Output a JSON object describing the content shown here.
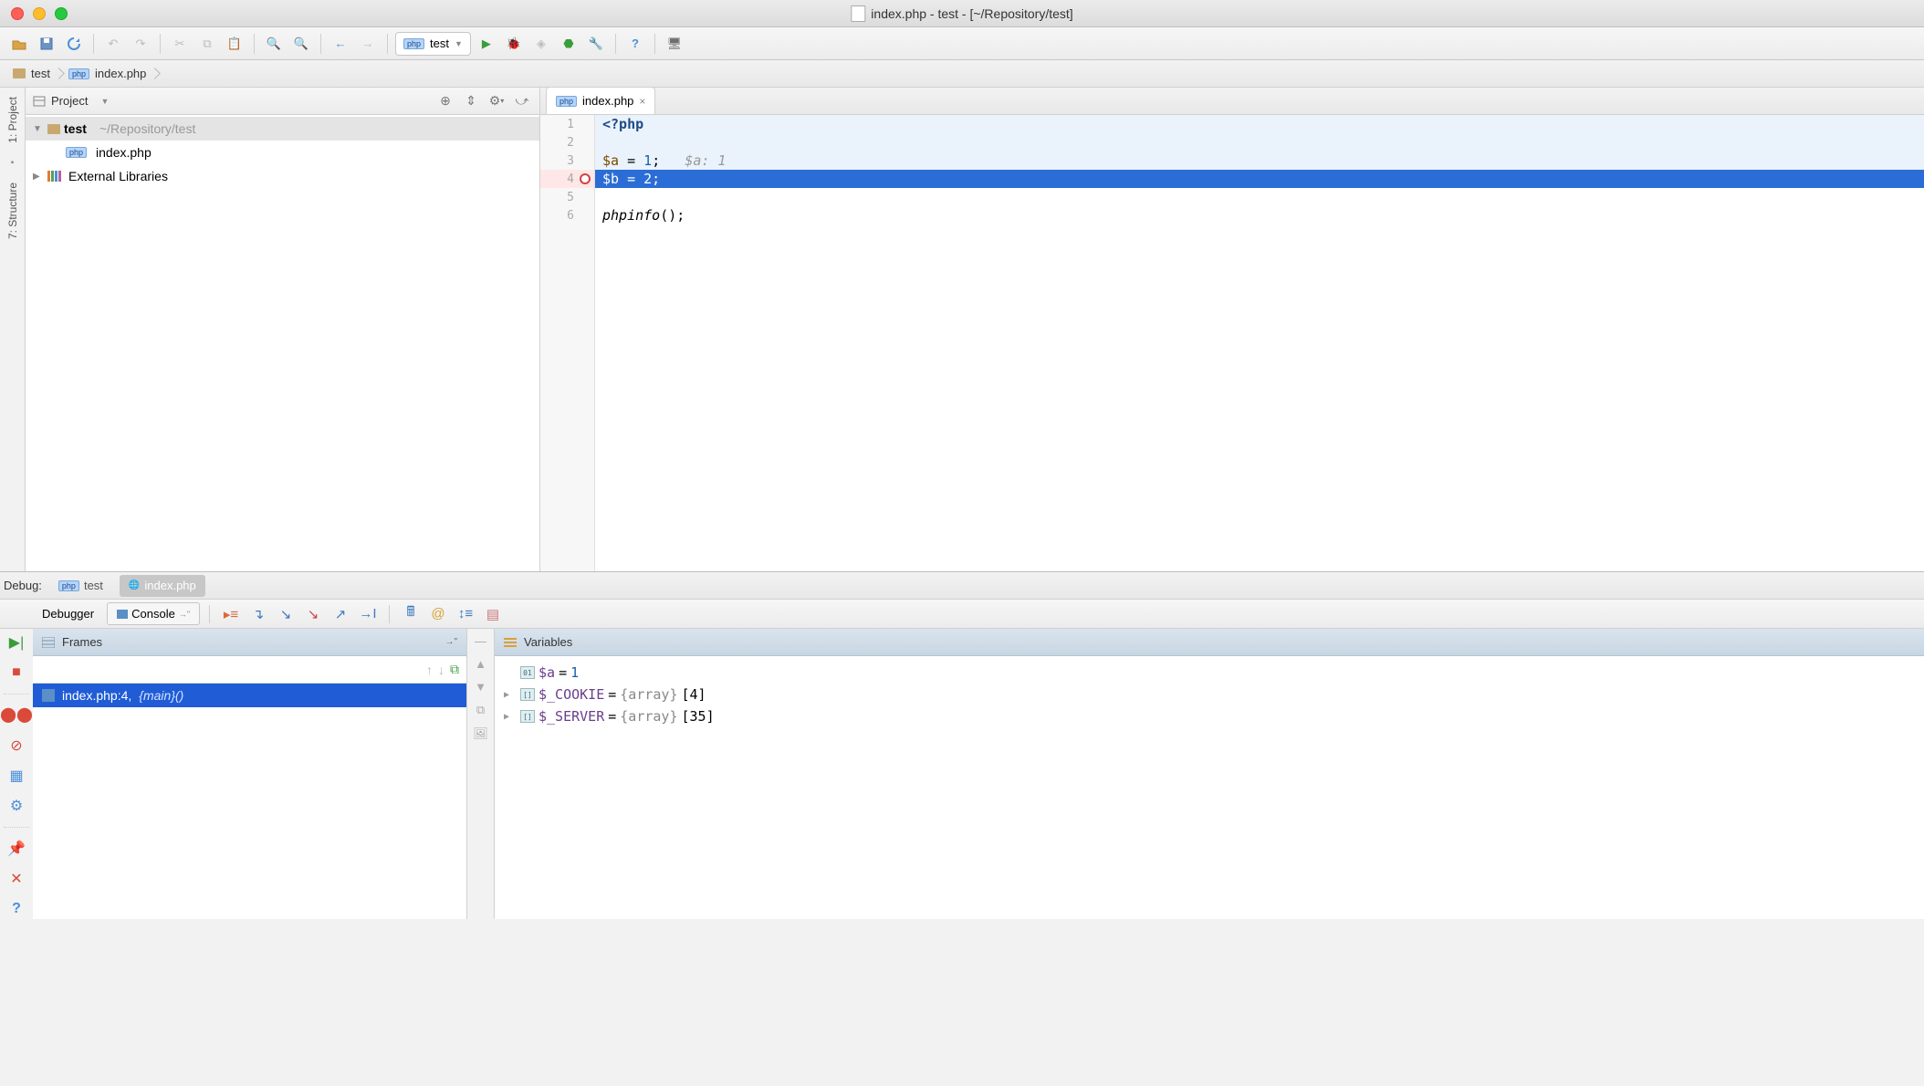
{
  "window": {
    "title": "index.php - test - [~/Repository/test]"
  },
  "toolbar": {
    "run_config": "test"
  },
  "breadcrumb": {
    "items": [
      "test",
      "index.php"
    ]
  },
  "sidebar": {
    "tabs": [
      "1: Project",
      "7: Structure"
    ]
  },
  "project_panel": {
    "title": "Project",
    "root": {
      "name": "test",
      "path": "~/Repository/test"
    },
    "children": [
      "index.php"
    ],
    "ext_lib": "External Libraries"
  },
  "editor": {
    "tab": "index.php",
    "lines": [
      {
        "n": 1,
        "html": "<span class='kw'>&lt;?php</span>",
        "lightblue": true
      },
      {
        "n": 2,
        "html": "",
        "lightblue": true
      },
      {
        "n": 3,
        "html": "<span class='var'>$a</span> = <span class='num'>1</span>;   <span class='hint'>$a: 1</span>",
        "lightblue": true
      },
      {
        "n": 4,
        "html": "$b = 2;",
        "selected": true,
        "breakpoint": true
      },
      {
        "n": 5,
        "html": ""
      },
      {
        "n": 6,
        "html": "<span class='fn'>phpinfo</span>();"
      }
    ]
  },
  "debug": {
    "label": "Debug:",
    "tabs": {
      "test": "test",
      "index": "index.php"
    },
    "toolbar_tabs": {
      "debugger": "Debugger",
      "console": "Console"
    },
    "frames": {
      "title": "Frames",
      "row": {
        "file": "index.php:4,",
        "main": "{main}()"
      }
    },
    "vars": {
      "title": "Variables",
      "items": [
        {
          "exp": "",
          "name": "$a",
          "eq": " = ",
          "val": "1",
          "type": "int"
        },
        {
          "exp": "▶",
          "name": "$_COOKIE",
          "eq": " = ",
          "grey": "{array} ",
          "count": "[4]"
        },
        {
          "exp": "▶",
          "name": "$_SERVER",
          "eq": " = ",
          "grey": "{array} ",
          "count": "[35]"
        }
      ]
    }
  }
}
